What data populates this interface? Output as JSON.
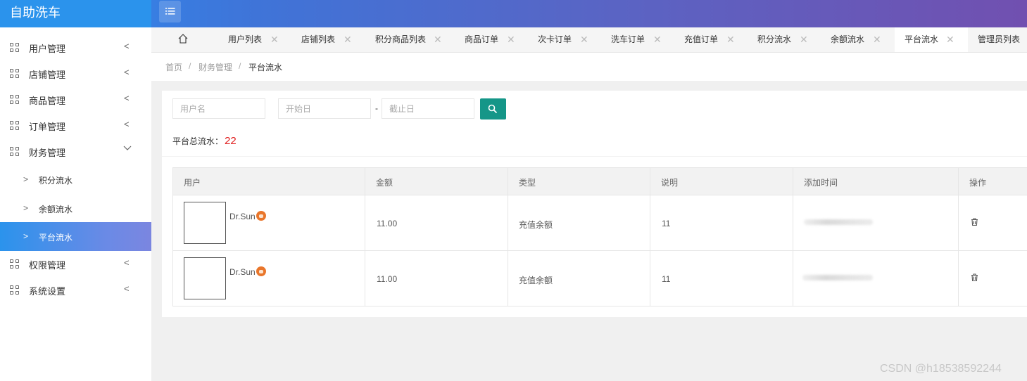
{
  "app": {
    "title": "自助洗车"
  },
  "header": {
    "menu_icon": "list-icon"
  },
  "sidebar": {
    "items": [
      {
        "label": "用户管理",
        "expanded": false
      },
      {
        "label": "店铺管理",
        "expanded": false
      },
      {
        "label": "商品管理",
        "expanded": false
      },
      {
        "label": "订单管理",
        "expanded": false
      },
      {
        "label": "财务管理",
        "expanded": true,
        "children": [
          {
            "label": "积分流水",
            "active": false
          },
          {
            "label": "余额流水",
            "active": false
          },
          {
            "label": "平台流水",
            "active": true
          }
        ]
      },
      {
        "label": "权限管理",
        "expanded": false
      },
      {
        "label": "系统设置",
        "expanded": false
      }
    ]
  },
  "tabs": [
    {
      "label": "用户列表"
    },
    {
      "label": "店铺列表"
    },
    {
      "label": "积分商品列表"
    },
    {
      "label": "商品订单"
    },
    {
      "label": "次卡订单"
    },
    {
      "label": "洗车订单"
    },
    {
      "label": "充值订单"
    },
    {
      "label": "积分流水"
    },
    {
      "label": "余额流水"
    },
    {
      "label": "平台流水",
      "active": true
    },
    {
      "label": "管理员列表"
    }
  ],
  "breadcrumb": {
    "home": "首页",
    "section": "财务管理",
    "current": "平台流水",
    "separator": "/"
  },
  "filters": {
    "username_placeholder": "用户名",
    "start_placeholder": "开始日",
    "end_placeholder": "截止日",
    "range_separator": "-"
  },
  "summary": {
    "label": "平台总流水：",
    "value": "22"
  },
  "table": {
    "columns": [
      "用户",
      "金额",
      "类型",
      "说明",
      "添加时间",
      "操作"
    ],
    "rows": [
      {
        "user": "Dr.Sun",
        "amount": "11.00",
        "type": "充值余额",
        "note": "11",
        "time": ""
      },
      {
        "user": "Dr.Sun",
        "amount": "11.00",
        "type": "充值余额",
        "note": "11",
        "time": ""
      }
    ]
  },
  "watermark": "CSDN @h18538592244",
  "colors": {
    "header_start": "#2d8cf0",
    "header_end": "#7150b0",
    "search_button": "#159688",
    "total_value": "#e02020"
  }
}
